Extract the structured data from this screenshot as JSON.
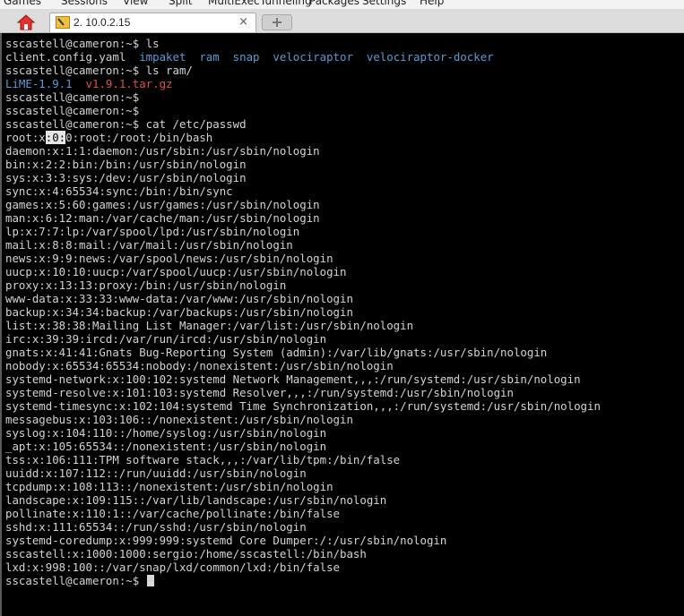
{
  "menubar": {
    "items": [
      "Games",
      "Sessions",
      "View",
      "Split",
      "MultiExec",
      "Tunneling",
      "Packages",
      "Settings",
      "Help"
    ]
  },
  "tab": {
    "title": "2. 10.0.2.15",
    "close_glyph": "×"
  },
  "colors": {
    "dir": "#5b9bd5",
    "archive": "#e05050",
    "plain": "#d4d4d4",
    "background": "#000000"
  },
  "terminal": {
    "lines": [
      [
        {
          "t": "sscastell@cameron:~$ ls",
          "c": "plain"
        }
      ],
      [
        {
          "t": "client.config.yaml  ",
          "c": "plain"
        },
        {
          "t": "impaket",
          "c": "dir"
        },
        {
          "t": "  ",
          "c": "plain"
        },
        {
          "t": "ram",
          "c": "dir"
        },
        {
          "t": "  ",
          "c": "plain"
        },
        {
          "t": "snap",
          "c": "dir"
        },
        {
          "t": "  ",
          "c": "plain"
        },
        {
          "t": "velociraptor",
          "c": "dir"
        },
        {
          "t": "  ",
          "c": "plain"
        },
        {
          "t": "velociraptor-docker",
          "c": "dir"
        }
      ],
      [
        {
          "t": "sscastell@cameron:~$ ls ram/",
          "c": "plain"
        }
      ],
      [
        {
          "t": "LiME-1.9.1",
          "c": "dir"
        },
        {
          "t": "  ",
          "c": "plain"
        },
        {
          "t": "v1.9.1.tar.gz",
          "c": "archive"
        }
      ],
      [
        {
          "t": "sscastell@cameron:~$",
          "c": "plain"
        }
      ],
      [
        {
          "t": "sscastell@cameron:~$",
          "c": "plain"
        }
      ],
      [
        {
          "t": "sscastell@cameron:~$ cat /etc/passwd",
          "c": "plain"
        }
      ],
      [
        {
          "t": "root:x",
          "c": "plain"
        },
        {
          "t": ":0:",
          "c": "sel"
        },
        {
          "t": "0:root:/root:/bin/bash",
          "c": "plain"
        }
      ],
      [
        {
          "t": "daemon:x:1:1:daemon:/usr/sbin:/usr/sbin/nologin",
          "c": "plain"
        }
      ],
      [
        {
          "t": "bin:x:2:2:bin:/bin:/usr/sbin/nologin",
          "c": "plain"
        }
      ],
      [
        {
          "t": "sys:x:3:3:sys:/dev:/usr/sbin/nologin",
          "c": "plain"
        }
      ],
      [
        {
          "t": "sync:x:4:65534:sync:/bin:/bin/sync",
          "c": "plain"
        }
      ],
      [
        {
          "t": "games:x:5:60:games:/usr/games:/usr/sbin/nologin",
          "c": "plain"
        }
      ],
      [
        {
          "t": "man:x:6:12:man:/var/cache/man:/usr/sbin/nologin",
          "c": "plain"
        }
      ],
      [
        {
          "t": "lp:x:7:7:lp:/var/spool/lpd:/usr/sbin/nologin",
          "c": "plain"
        }
      ],
      [
        {
          "t": "mail:x:8:8:mail:/var/mail:/usr/sbin/nologin",
          "c": "plain"
        }
      ],
      [
        {
          "t": "news:x:9:9:news:/var/spool/news:/usr/sbin/nologin",
          "c": "plain"
        }
      ],
      [
        {
          "t": "uucp:x:10:10:uucp:/var/spool/uucp:/usr/sbin/nologin",
          "c": "plain"
        }
      ],
      [
        {
          "t": "proxy:x:13:13:proxy:/bin:/usr/sbin/nologin",
          "c": "plain"
        }
      ],
      [
        {
          "t": "www-data:x:33:33:www-data:/var/www:/usr/sbin/nologin",
          "c": "plain"
        }
      ],
      [
        {
          "t": "backup:x:34:34:backup:/var/backups:/usr/sbin/nologin",
          "c": "plain"
        }
      ],
      [
        {
          "t": "list:x:38:38:Mailing List Manager:/var/list:/usr/sbin/nologin",
          "c": "plain"
        }
      ],
      [
        {
          "t": "irc:x:39:39:ircd:/var/run/ircd:/usr/sbin/nologin",
          "c": "plain"
        }
      ],
      [
        {
          "t": "gnats:x:41:41:Gnats Bug-Reporting System (admin):/var/lib/gnats:/usr/sbin/nologin",
          "c": "plain"
        }
      ],
      [
        {
          "t": "nobody:x:65534:65534:nobody:/nonexistent:/usr/sbin/nologin",
          "c": "plain"
        }
      ],
      [
        {
          "t": "systemd-network:x:100:102:systemd Network Management,,,:/run/systemd:/usr/sbin/nologin",
          "c": "plain"
        }
      ],
      [
        {
          "t": "systemd-resolve:x:101:103:systemd Resolver,,,:/run/systemd:/usr/sbin/nologin",
          "c": "plain"
        }
      ],
      [
        {
          "t": "systemd-timesync:x:102:104:systemd Time Synchronization,,,:/run/systemd:/usr/sbin/nologin",
          "c": "plain"
        }
      ],
      [
        {
          "t": "messagebus:x:103:106::/nonexistent:/usr/sbin/nologin",
          "c": "plain"
        }
      ],
      [
        {
          "t": "syslog:x:104:110::/home/syslog:/usr/sbin/nologin",
          "c": "plain"
        }
      ],
      [
        {
          "t": "_apt:x:105:65534::/nonexistent:/usr/sbin/nologin",
          "c": "plain"
        }
      ],
      [
        {
          "t": "tss:x:106:111:TPM software stack,,,:/var/lib/tpm:/bin/false",
          "c": "plain"
        }
      ],
      [
        {
          "t": "uuidd:x:107:112::/run/uuidd:/usr/sbin/nologin",
          "c": "plain"
        }
      ],
      [
        {
          "t": "tcpdump:x:108:113::/nonexistent:/usr/sbin/nologin",
          "c": "plain"
        }
      ],
      [
        {
          "t": "landscape:x:109:115::/var/lib/landscape:/usr/sbin/nologin",
          "c": "plain"
        }
      ],
      [
        {
          "t": "pollinate:x:110:1::/var/cache/pollinate:/bin/false",
          "c": "plain"
        }
      ],
      [
        {
          "t": "sshd:x:111:65534::/run/sshd:/usr/sbin/nologin",
          "c": "plain"
        }
      ],
      [
        {
          "t": "systemd-coredump:x:999:999:systemd Core Dumper:/:/usr/sbin/nologin",
          "c": "plain"
        }
      ],
      [
        {
          "t": "sscastell:x:1000:1000:sergio:/home/sscastell:/bin/bash",
          "c": "plain"
        }
      ],
      [
        {
          "t": "lxd:x:998:100::/var/snap/lxd/common/lxd:/bin/false",
          "c": "plain"
        }
      ],
      [
        {
          "t": "sscastell@cameron:~$ ",
          "c": "plain"
        }
      ]
    ]
  }
}
